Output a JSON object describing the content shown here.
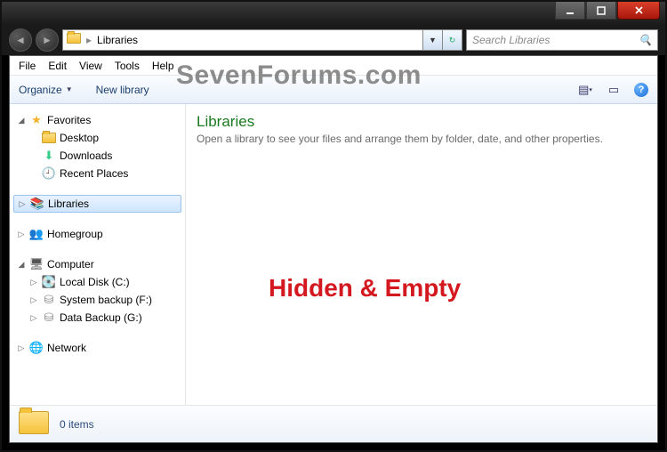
{
  "titlebar": {},
  "nav": {
    "location": "Libraries",
    "search_placeholder": "Search Libraries"
  },
  "menubar": [
    "File",
    "Edit",
    "View",
    "Tools",
    "Help"
  ],
  "toolbar": {
    "organize": "Organize",
    "newlib": "New library"
  },
  "tree": {
    "favorites": {
      "label": "Favorites",
      "items": [
        "Desktop",
        "Downloads",
        "Recent Places"
      ]
    },
    "libraries": {
      "label": "Libraries"
    },
    "homegroup": {
      "label": "Homegroup"
    },
    "computer": {
      "label": "Computer",
      "items": [
        "Local Disk (C:)",
        "System backup (F:)",
        "Data Backup (G:)"
      ]
    },
    "network": {
      "label": "Network"
    }
  },
  "content": {
    "heading": "Libraries",
    "subheading": "Open a library to see your files and arrange them by folder, date, and other properties."
  },
  "status": {
    "items": "0 items"
  },
  "watermark": "SevenForums.com",
  "overlay": "Hidden & Empty"
}
